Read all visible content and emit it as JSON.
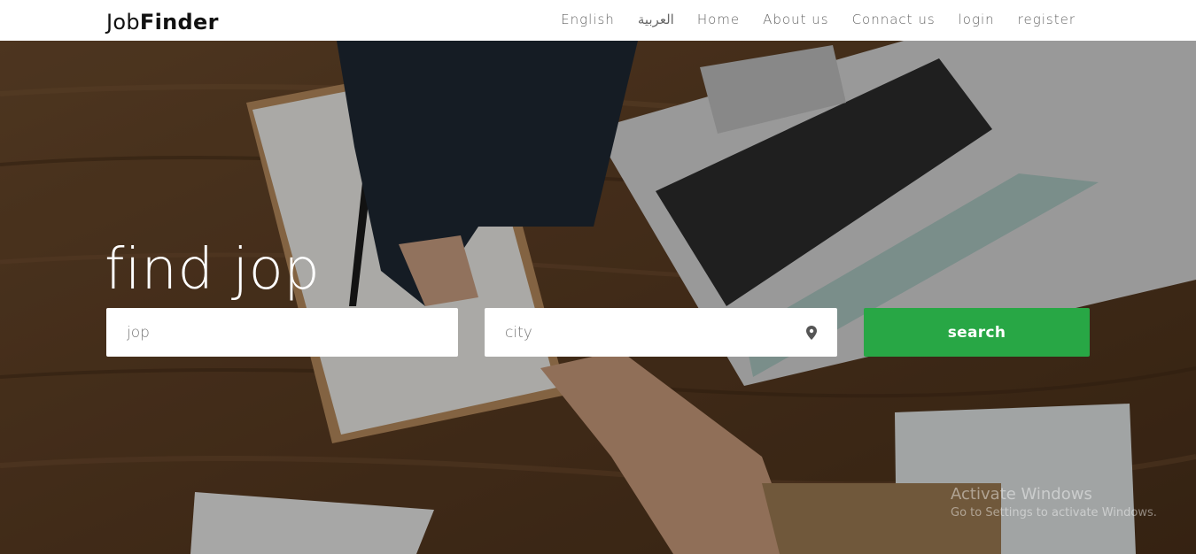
{
  "navbar": {
    "brand_light": "Job",
    "brand_bold": "Finder",
    "links": [
      "English",
      "العربية",
      "Home",
      "About us",
      "Connact us",
      "login",
      "register"
    ]
  },
  "hero": {
    "headline": "find jop",
    "job_field": {
      "placeholder": "jop",
      "value": ""
    },
    "city_field": {
      "placeholder": "city",
      "value": ""
    },
    "search_label": "search",
    "icons": {
      "city": "map-pin-icon"
    }
  },
  "watermark": {
    "title": "Activate Windows",
    "subtitle": "Go to Settings to activate Windows."
  },
  "colors": {
    "accent": "#28a745",
    "nav_text": "#666666",
    "brand_text": "#111111"
  }
}
